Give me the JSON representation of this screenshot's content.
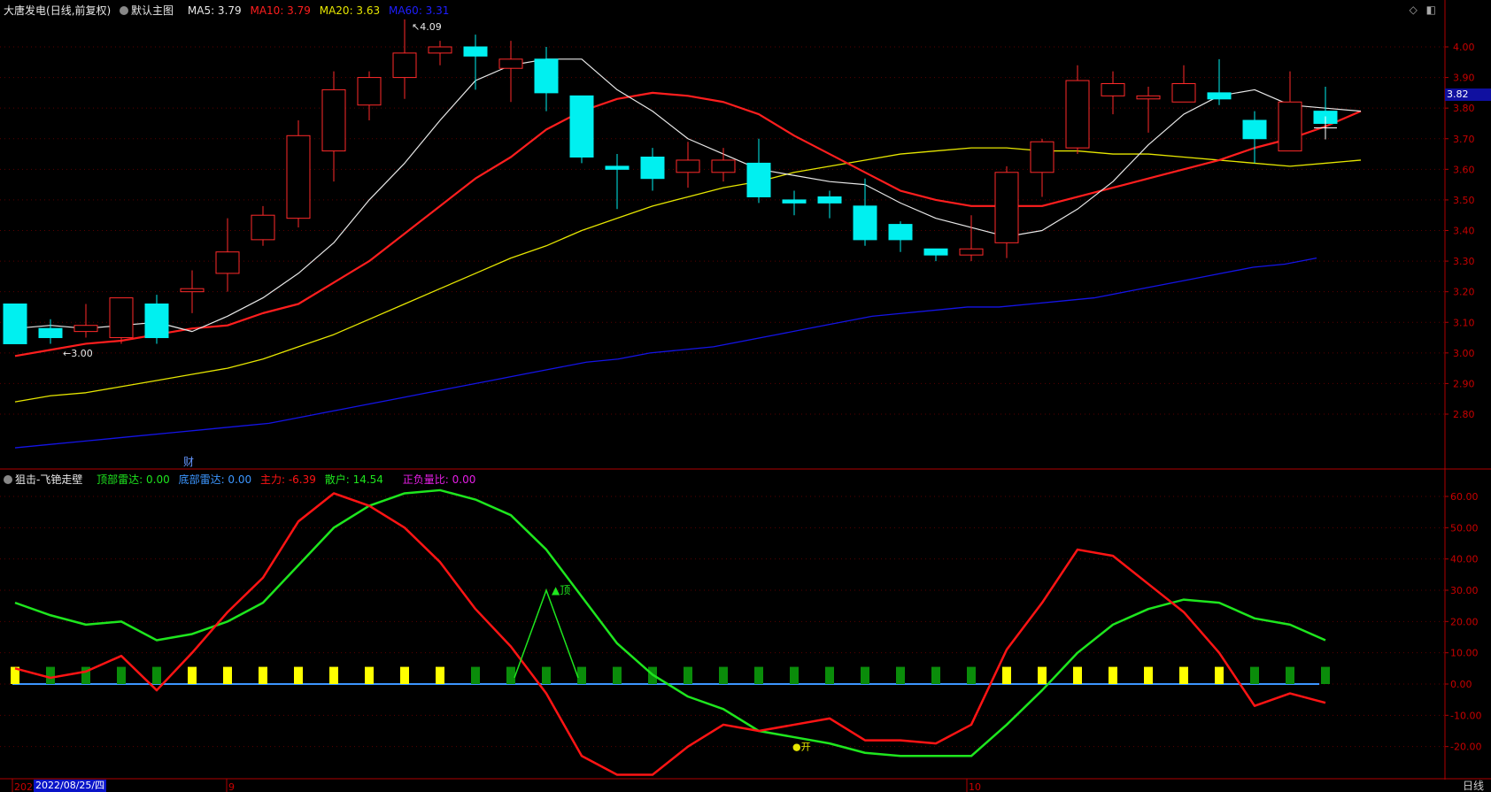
{
  "main_header": {
    "stock_name": "大唐发电",
    "period_info": "(日线,前复权)",
    "panel_name": "默认主图",
    "ma5": "MA5: 3.79",
    "ma10": "MA10: 3.79",
    "ma20": "MA20: 3.63",
    "ma60": "MA60: 3.31"
  },
  "window_icons": [
    "◇",
    "◧"
  ],
  "price_tag": "3.82",
  "cursor_date": "2022/08/25/四",
  "period": "日线",
  "x_markers": [
    "2022",
    "9",
    "10"
  ],
  "finance_marker": "财",
  "sub_header": {
    "name": "狙击-飞铯走壁",
    "top_radar": "顶部雷达: 0.00",
    "bottom_radar": "底部雷达: 0.00",
    "main_force": "主力: -6.39",
    "retail": "散户: 14.54",
    "ratio": "正负量比: 0.00"
  },
  "colors": {
    "up": "#ff2a2a",
    "down": "#00f0f0",
    "ma5": "#e8e8e8",
    "ma10": "#ff1e1e",
    "ma20": "#e6e600",
    "ma60": "#1414e6",
    "axis": "#b00000",
    "ind_main": "#ff1414",
    "ind_retail": "#1ee61e",
    "bar_yellow": "#ffff00",
    "bar_green": "#0a8c0a"
  },
  "chart_data": [
    {
      "type": "candlestick",
      "ylim": [
        2.7,
        4.1
      ],
      "y_ticks": [
        "4.00",
        "3.90",
        "3.80",
        "3.70",
        "3.60",
        "3.50",
        "3.40",
        "3.30",
        "3.20",
        "3.10",
        "3.00",
        "2.90",
        "2.80"
      ],
      "candles": [
        {
          "o": 3.16,
          "h": 3.16,
          "l": 3.03,
          "c": 3.03
        },
        {
          "o": 3.08,
          "h": 3.11,
          "l": 3.03,
          "c": 3.05
        },
        {
          "o": 3.07,
          "h": 3.16,
          "l": 3.05,
          "c": 3.09
        },
        {
          "o": 3.05,
          "h": 3.18,
          "l": 3.03,
          "c": 3.18
        },
        {
          "o": 3.16,
          "h": 3.19,
          "l": 3.03,
          "c": 3.05
        },
        {
          "o": 3.2,
          "h": 3.27,
          "l": 3.13,
          "c": 3.21
        },
        {
          "o": 3.26,
          "h": 3.44,
          "l": 3.2,
          "c": 3.33
        },
        {
          "o": 3.37,
          "h": 3.48,
          "l": 3.35,
          "c": 3.45
        },
        {
          "o": 3.44,
          "h": 3.76,
          "l": 3.41,
          "c": 3.71
        },
        {
          "o": 3.66,
          "h": 3.92,
          "l": 3.56,
          "c": 3.86
        },
        {
          "o": 3.81,
          "h": 3.92,
          "l": 3.76,
          "c": 3.9
        },
        {
          "o": 3.9,
          "h": 4.09,
          "l": 3.83,
          "c": 3.98
        },
        {
          "o": 3.98,
          "h": 4.02,
          "l": 3.94,
          "c": 4.0
        },
        {
          "o": 4.0,
          "h": 4.04,
          "l": 3.86,
          "c": 3.97
        },
        {
          "o": 3.93,
          "h": 4.02,
          "l": 3.82,
          "c": 3.96
        },
        {
          "o": 3.96,
          "h": 4.0,
          "l": 3.79,
          "c": 3.85
        },
        {
          "o": 3.84,
          "h": 3.84,
          "l": 3.62,
          "c": 3.64
        },
        {
          "o": 3.61,
          "h": 3.65,
          "l": 3.47,
          "c": 3.6
        },
        {
          "o": 3.64,
          "h": 3.67,
          "l": 3.53,
          "c": 3.57
        },
        {
          "o": 3.59,
          "h": 3.69,
          "l": 3.54,
          "c": 3.63
        },
        {
          "o": 3.59,
          "h": 3.67,
          "l": 3.56,
          "c": 3.63
        },
        {
          "o": 3.62,
          "h": 3.7,
          "l": 3.49,
          "c": 3.51
        },
        {
          "o": 3.5,
          "h": 3.53,
          "l": 3.45,
          "c": 3.49
        },
        {
          "o": 3.51,
          "h": 3.53,
          "l": 3.44,
          "c": 3.49
        },
        {
          "o": 3.48,
          "h": 3.57,
          "l": 3.35,
          "c": 3.37
        },
        {
          "o": 3.42,
          "h": 3.43,
          "l": 3.33,
          "c": 3.37
        },
        {
          "o": 3.34,
          "h": 3.34,
          "l": 3.3,
          "c": 3.32
        },
        {
          "o": 3.32,
          "h": 3.45,
          "l": 3.3,
          "c": 3.34
        },
        {
          "o": 3.36,
          "h": 3.61,
          "l": 3.31,
          "c": 3.59
        },
        {
          "o": 3.59,
          "h": 3.7,
          "l": 3.51,
          "c": 3.69
        },
        {
          "o": 3.67,
          "h": 3.94,
          "l": 3.65,
          "c": 3.89
        },
        {
          "o": 3.84,
          "h": 3.92,
          "l": 3.78,
          "c": 3.88
        },
        {
          "o": 3.83,
          "h": 3.87,
          "l": 3.72,
          "c": 3.84
        },
        {
          "o": 3.82,
          "h": 3.94,
          "l": 3.82,
          "c": 3.88
        },
        {
          "o": 3.85,
          "h": 3.96,
          "l": 3.81,
          "c": 3.83
        },
        {
          "o": 3.76,
          "h": 3.79,
          "l": 3.62,
          "c": 3.7
        },
        {
          "o": 3.66,
          "h": 3.92,
          "l": 3.66,
          "c": 3.82
        },
        {
          "o": 3.79,
          "h": 3.87,
          "l": 3.73,
          "c": 3.75
        }
      ],
      "ma5": [
        3.08,
        3.09,
        3.08,
        3.09,
        3.1,
        3.07,
        3.12,
        3.18,
        3.26,
        3.36,
        3.5,
        3.62,
        3.76,
        3.89,
        3.94,
        3.96,
        3.96,
        3.86,
        3.79,
        3.7,
        3.65,
        3.6,
        3.58,
        3.56,
        3.55,
        3.49,
        3.44,
        3.41,
        3.38,
        3.4,
        3.47,
        3.56,
        3.68,
        3.78,
        3.84,
        3.86,
        3.81,
        3.8,
        3.79
      ],
      "ma10": [
        2.99,
        3.01,
        3.03,
        3.04,
        3.06,
        3.08,
        3.09,
        3.13,
        3.16,
        3.23,
        3.3,
        3.39,
        3.48,
        3.57,
        3.64,
        3.73,
        3.79,
        3.83,
        3.85,
        3.84,
        3.82,
        3.78,
        3.71,
        3.65,
        3.59,
        3.53,
        3.5,
        3.48,
        3.48,
        3.48,
        3.51,
        3.54,
        3.57,
        3.6,
        3.63,
        3.67,
        3.7,
        3.74,
        3.79
      ],
      "ma20": [
        2.84,
        2.86,
        2.87,
        2.89,
        2.91,
        2.93,
        2.95,
        2.98,
        3.02,
        3.06,
        3.11,
        3.16,
        3.21,
        3.26,
        3.31,
        3.35,
        3.4,
        3.44,
        3.48,
        3.51,
        3.54,
        3.56,
        3.59,
        3.61,
        3.63,
        3.65,
        3.66,
        3.67,
        3.67,
        3.66,
        3.66,
        3.65,
        3.65,
        3.64,
        3.63,
        3.62,
        3.61,
        3.62,
        3.63
      ],
      "ma60": [
        2.69,
        2.7,
        2.71,
        2.72,
        2.73,
        2.74,
        2.75,
        2.76,
        2.77,
        2.79,
        2.81,
        2.83,
        2.85,
        2.87,
        2.89,
        2.91,
        2.93,
        2.95,
        2.97,
        2.98,
        3.0,
        3.01,
        3.02,
        3.04,
        3.06,
        3.08,
        3.1,
        3.12,
        3.13,
        3.14,
        3.15,
        3.15,
        3.16,
        3.17,
        3.18,
        3.2,
        3.22,
        3.24,
        3.26,
        3.28,
        3.29,
        3.31
      ],
      "annotations": {
        "high": "4.09",
        "low": "3.00"
      }
    },
    {
      "type": "line",
      "ylim": [
        -30,
        67
      ],
      "y_ticks": [
        "60.00",
        "50.00",
        "40.00",
        "30.00",
        "20.00",
        "10.00",
        "0.00",
        "-10.00",
        "-20.00"
      ],
      "series": [
        {
          "name": "主力",
          "values": [
            5,
            2,
            4,
            9,
            -2,
            10,
            23,
            34,
            52,
            61,
            57,
            50,
            39,
            24,
            12,
            -3,
            -23,
            -29,
            -29,
            -20,
            -13,
            -15,
            -13,
            -11,
            -18,
            -18,
            -19,
            -13,
            11,
            26,
            43,
            41,
            32,
            23,
            10,
            -7,
            -3,
            -6
          ]
        },
        {
          "name": "散户",
          "values": [
            26,
            22,
            19,
            20,
            14,
            16,
            20,
            26,
            38,
            50,
            57,
            61,
            62,
            59,
            54,
            43,
            28,
            13,
            3,
            -4,
            -8,
            -15,
            -17,
            -19,
            -22,
            -23,
            -23,
            -23,
            -13,
            -2,
            10,
            19,
            24,
            27,
            26,
            21,
            19,
            14
          ]
        }
      ],
      "bar_colors": [
        "y",
        "g",
        "g",
        "g",
        "g",
        "y",
        "y",
        "y",
        "y",
        "y",
        "y",
        "y",
        "y",
        "g",
        "g",
        "g",
        "g",
        "g",
        "g",
        "g",
        "g",
        "g",
        "g",
        "g",
        "g",
        "g",
        "g",
        "g",
        "y",
        "y",
        "y",
        "y",
        "y",
        "y",
        "y",
        "g",
        "g",
        "g"
      ],
      "top_marker_label": "▲顶",
      "open_marker_label": "●开"
    }
  ]
}
